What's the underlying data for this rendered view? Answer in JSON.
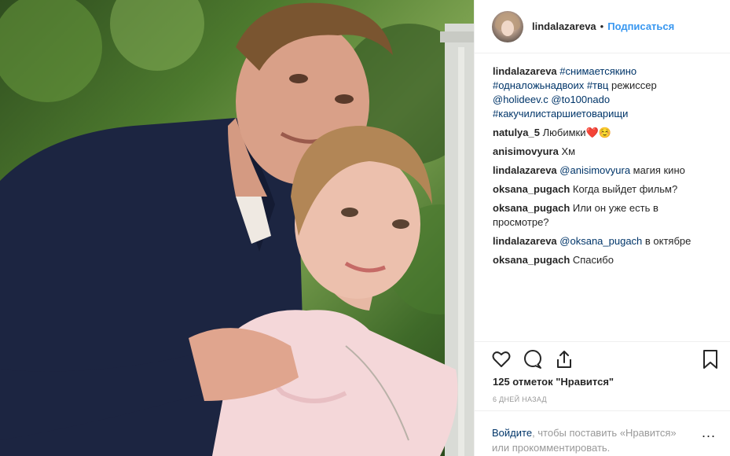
{
  "post": {
    "username": "lindalazareva",
    "dot": "•",
    "follow_label": "Подписаться"
  },
  "caption": {
    "user": "lindalazareva",
    "tag1": "#снимаетсякино",
    "tag2": "#одналожьнадвоих",
    "tag3": "#твц",
    "text_director": " режиссер",
    "mention1": "@holideev.c",
    "mention2": "@to100nado",
    "tag4": "#какучилистаршиетоварищи"
  },
  "comments": [
    {
      "user": "natulya_5",
      "text": " Любимки❤️☺️"
    },
    {
      "user": "anisimovyura",
      "text": " Хм"
    },
    {
      "user": "lindalazareva",
      "mention": "@anisimovyura",
      "text": " магия кино"
    },
    {
      "user": "oksana_pugach",
      "text": " Когда выйдет фильм?"
    },
    {
      "user": "oksana_pugach",
      "text": " Или он уже есть в просмотре?"
    },
    {
      "user": "lindalazareva",
      "mention": "@oksana_pugach",
      "text": " в октябре"
    },
    {
      "user": "oksana_pugach",
      "text": " Спасибо"
    }
  ],
  "stats": {
    "likes": "125 отметок \"Нравится\"",
    "time": "6 дней назад"
  },
  "footer": {
    "login_link": "Войдите",
    "login_text": ", чтобы поставить «Нравится» или прокомментировать.",
    "more": "..."
  },
  "icons": {
    "like": "heart-outline-icon",
    "comment": "speech-bubble-icon",
    "share": "share-arrow-icon",
    "save": "bookmark-icon",
    "more": "ellipsis-icon"
  },
  "colors": {
    "link": "#003569",
    "follow": "#3897f0",
    "muted": "#999999",
    "text": "#262626"
  }
}
